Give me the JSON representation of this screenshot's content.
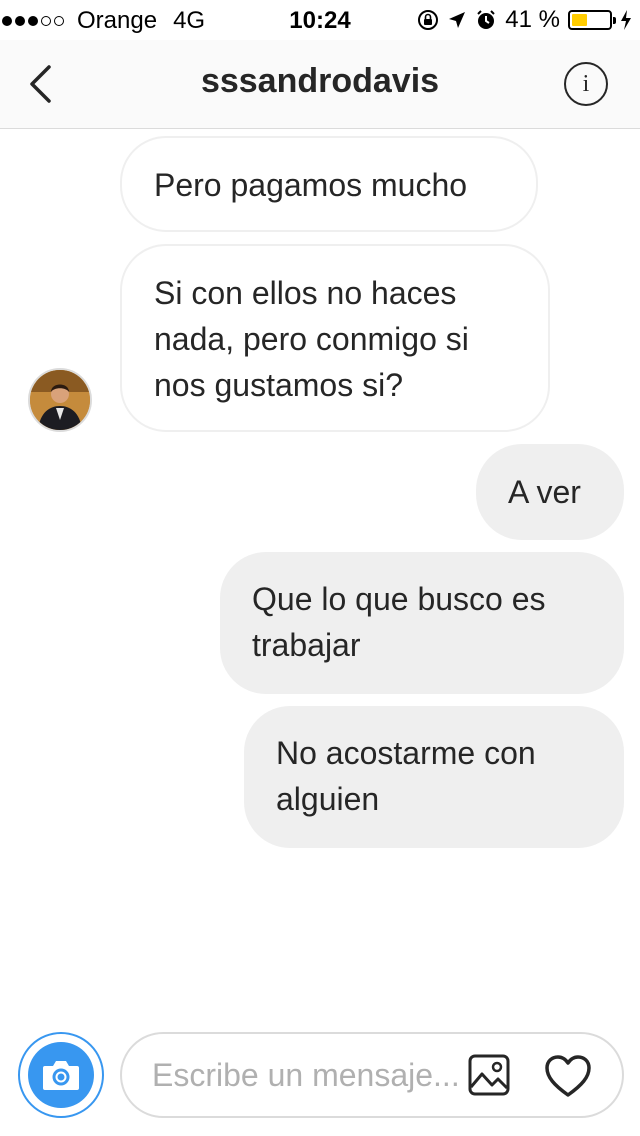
{
  "status_bar": {
    "carrier": "Orange",
    "network": "4G",
    "time": "10:24",
    "battery_percent": "41 %",
    "battery_level": 0.41,
    "battery_color": "#ffcc00"
  },
  "header": {
    "username": "sssandrodavis",
    "back_icon": "chevron-left-icon",
    "info_icon": "info-icon",
    "info_glyph": "i"
  },
  "messages": [
    {
      "from": "them",
      "lines": [
        "Pero pagamos mucho"
      ]
    },
    {
      "from": "them",
      "lines": [
        "Si con ellos no haces",
        "nada, pero conmigo si",
        "nos gustamos si?"
      ]
    },
    {
      "from": "me",
      "lines": [
        "A ver"
      ]
    },
    {
      "from": "me",
      "lines": [
        "Que lo que busco es",
        "trabajar"
      ]
    },
    {
      "from": "me",
      "lines": [
        "No acostarme con",
        "alguien"
      ]
    }
  ],
  "composer": {
    "placeholder": "Escribe un mensaje...",
    "camera_icon": "camera-icon",
    "gallery_icon": "gallery-icon",
    "like_icon": "heart-icon"
  },
  "colors": {
    "accent": "#3897f0",
    "outgoing_bubble": "#efefef",
    "incoming_border": "#efefef",
    "divider": "#dbdbdb"
  }
}
